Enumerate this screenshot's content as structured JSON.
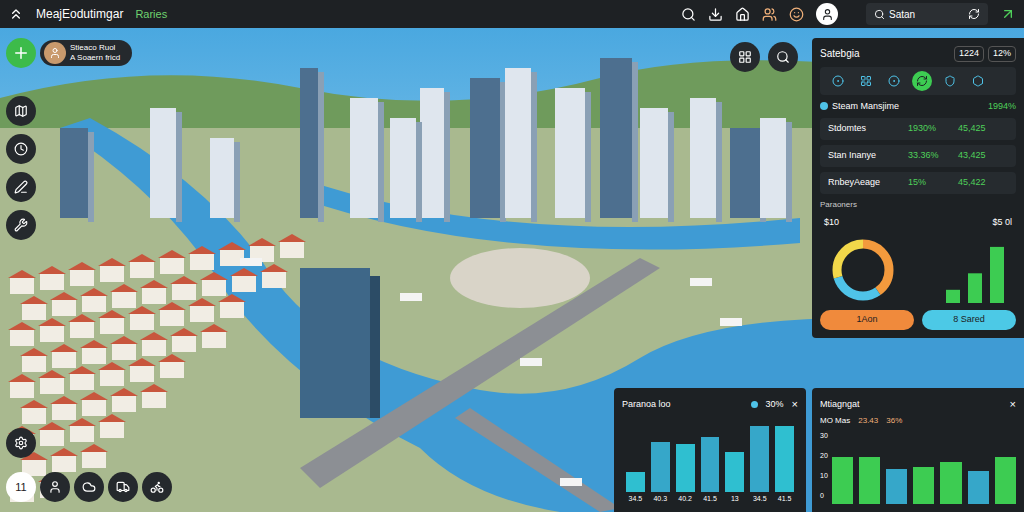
{
  "app": {
    "title": "MeajEodutimgar",
    "subtitle": "Raries"
  },
  "search": {
    "value": "Satan"
  },
  "player": {
    "line1": "Stieaco Ruol",
    "line2": "A Soaern fricd"
  },
  "bottom_toolbar": {
    "counter": "11"
  },
  "stats_panel": {
    "title": "Satebgia",
    "badges": [
      "1224",
      "12%"
    ],
    "tabs": [
      {
        "selected": false
      },
      {
        "selected": false
      },
      {
        "selected": false
      },
      {
        "selected": true
      },
      {
        "selected": false
      },
      {
        "selected": false
      }
    ],
    "section": {
      "title": "Steam Mansjime",
      "value": "1994%"
    },
    "rows": [
      {
        "name": "Stdomtes",
        "share": "1930%",
        "value": "45,425"
      },
      {
        "name": "Stan Inanye",
        "share": "33.36%",
        "value": "43,425"
      },
      {
        "name": "RnbeyAeage",
        "share": "15%",
        "value": "45,422"
      }
    ],
    "chart_title": "Paraoners",
    "ticks": [
      "$10",
      "$5 0l"
    ],
    "donut": [
      {
        "value": 40,
        "color": "#f39a3d"
      },
      {
        "value": 30,
        "color": "#4fc3e8"
      },
      {
        "value": 30,
        "color": "#f2d84a"
      }
    ],
    "bars": [
      20,
      45,
      85
    ],
    "buttons": [
      {
        "label": "1Aon",
        "color": "#f08a3c"
      },
      {
        "label": "8 Sared",
        "color": "#4cc9e6"
      }
    ]
  },
  "population_panel": {
    "title": "Paranoa loo",
    "legend": "30%",
    "close": "×",
    "labels": [
      "34.5",
      "40.3",
      "40.2",
      "41.5",
      "13",
      "34.5",
      "41.5"
    ],
    "values": [
      20,
      50,
      48,
      55,
      40,
      66,
      66
    ]
  },
  "management_panel": {
    "title": "Mtiagngat",
    "close": "×",
    "stats": [
      "MO Mas",
      "23.43",
      "36%"
    ],
    "ticks": [
      "30",
      "20",
      "10",
      "0"
    ],
    "values": [
      20,
      20,
      15,
      16,
      18,
      14,
      20
    ]
  }
}
